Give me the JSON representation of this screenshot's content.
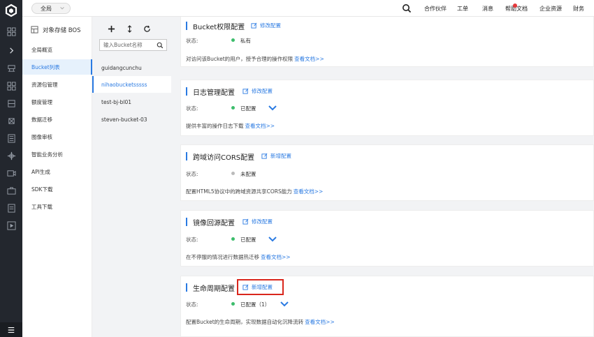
{
  "header": {
    "region": "全局",
    "links": [
      "合作伙伴",
      "工单",
      "消息",
      "帮助文档",
      "企业资源",
      "财务"
    ]
  },
  "sidebar": {
    "title": "对象存储 BOS",
    "items": [
      {
        "label": "全局概览"
      },
      {
        "label": "Bucket列表",
        "active": true
      },
      {
        "label": "资源包管理"
      },
      {
        "label": "额度管理"
      },
      {
        "label": "数据迁移"
      },
      {
        "label": "图像审核"
      },
      {
        "label": "智能业务分析"
      },
      {
        "label": "API生成"
      },
      {
        "label": "SDK下载"
      },
      {
        "label": "工具下载"
      }
    ]
  },
  "bucket_panel": {
    "search_placeholder": "输入Bucket名称",
    "buckets": [
      {
        "name": "guidangcunchu"
      },
      {
        "name": "nihaobucketsssss",
        "active": true
      },
      {
        "name": "test-bj-bl01"
      },
      {
        "name": "steven-bucket-03"
      }
    ]
  },
  "cards": [
    {
      "title": "Bucket权限配置",
      "action": "修改配置",
      "status_label": "状态:",
      "status_value": "私有",
      "status_color": "#3dbd6c",
      "description": "对访问该Bucket的用户，授予合理的操作权限",
      "doc_link": "查看文档>>"
    },
    {
      "title": "日志管理配置",
      "action": "修改配置",
      "status_label": "状态:",
      "status_value": "已配置",
      "status_color": "#3dbd6c",
      "description": "提供丰富的操作日志下载",
      "doc_link": "查看文档>>"
    },
    {
      "title": "跨域访问CORS配置",
      "action": "新增配置",
      "status_label": "状态:",
      "status_value": "未配置",
      "status_color": "#bbbbbb",
      "description": "配置HTML5协议中的跨域资源共享CORS能力",
      "doc_link": "查看文档>>"
    },
    {
      "title": "镜像回源配置",
      "action": "修改配置",
      "status_label": "状态:",
      "status_value": "已配置",
      "status_color": "#3dbd6c",
      "description": "在不停服的情况进行数据热迁移",
      "doc_link": "查看文档>>"
    },
    {
      "title": "生命周期配置",
      "action": "新增配置",
      "status_label": "状态:",
      "status_value": "已配置（1）",
      "status_color": "#3dbd6c",
      "description": "配置Bucket的生命周期，实现数据自动化沉降流转",
      "doc_link": "查看文档>>"
    }
  ]
}
